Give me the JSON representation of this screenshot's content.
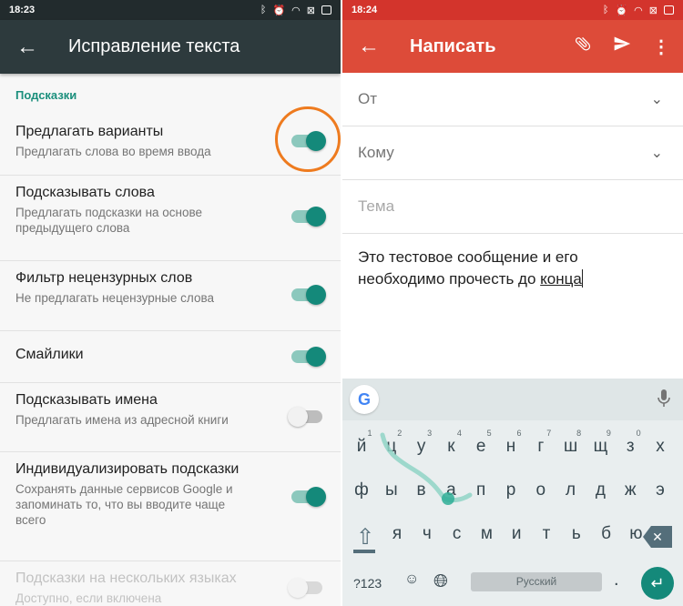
{
  "left": {
    "status": {
      "time": "18:23"
    },
    "appbar": {
      "back_icon": "←",
      "title": "Исправление текста"
    },
    "section_header": "Подсказки",
    "settings": [
      {
        "title": "Предлагать варианты",
        "subtitle": "Предлагать слова во время ввода",
        "state": "on"
      },
      {
        "title": "Подсказывать слова",
        "subtitle": "Предлагать подсказки на основе предыдущего слова",
        "state": "on"
      },
      {
        "title": "Фильтр нецензурных слов",
        "subtitle": "Не предлагать нецензурные слова",
        "state": "on"
      },
      {
        "title": "Смайлики",
        "subtitle": "",
        "state": "on"
      },
      {
        "title": "Подсказывать имена",
        "subtitle": "Предлагать имена из адресной книги",
        "state": "off"
      },
      {
        "title": "Индивидуализировать подсказки",
        "subtitle": "Сохранять данные сервисов Google и запоминать то, что вы вводите чаще всего",
        "state": "on"
      },
      {
        "title": "Подсказки на нескольких языках",
        "subtitle": "Доступно, если включена",
        "state": "off",
        "disabled": true
      }
    ],
    "highlight_color": "#ee7b1f",
    "accent": "#14897a"
  },
  "right": {
    "status": {
      "time": "18:24"
    },
    "appbar": {
      "back_icon": "←",
      "title": "Написать",
      "attach_icon": "paperclip-icon",
      "send_icon": "send-icon",
      "more_icon": "more-vert-icon"
    },
    "fields": {
      "from_label": "От",
      "to_label": "Кому",
      "subject_placeholder": "Тема"
    },
    "body": {
      "line1": "Это тестовое сообщение и его",
      "line2_prefix": "необходимо прочесть  до ",
      "line2_underlined": "конца"
    },
    "keyboard": {
      "row1": [
        "й",
        "ц",
        "у",
        "к",
        "е",
        "н",
        "г",
        "ш",
        "щ",
        "з",
        "х"
      ],
      "row1_hints": [
        "1",
        "2",
        "3",
        "4",
        "5",
        "6",
        "7",
        "8",
        "9",
        "0"
      ],
      "row2": [
        "ф",
        "ы",
        "в",
        "а",
        "п",
        "р",
        "о",
        "л",
        "д",
        "ж",
        "э"
      ],
      "row3": [
        "я",
        "ч",
        "с",
        "м",
        "и",
        "т",
        "ь",
        "б",
        "ю"
      ],
      "numbers_key": "?123",
      "emoji_key": "☺",
      "space_label": "Русский",
      "period_key": ".",
      "google_logo": "G"
    },
    "appbar_color": "#dd4b39"
  }
}
